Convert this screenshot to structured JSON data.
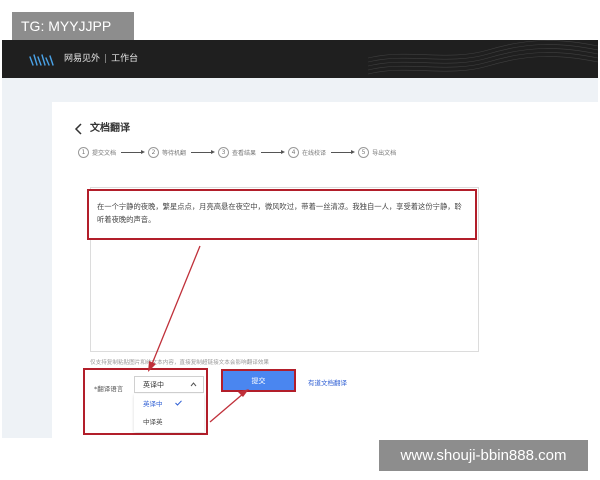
{
  "watermark": {
    "tg_text": "TG: MYYJJPP",
    "url_text": "www.shouji-bbin888.com"
  },
  "header": {
    "brand": "网易见外",
    "workspace": "工作台"
  },
  "page": {
    "title": "文档翻译"
  },
  "steps": [
    {
      "num": "1",
      "label": "提交文档"
    },
    {
      "num": "2",
      "label": "等待机翻"
    },
    {
      "num": "3",
      "label": "查看结果"
    },
    {
      "num": "4",
      "label": "在线校译"
    },
    {
      "num": "5",
      "label": "导出文档"
    }
  ],
  "editor": {
    "content": "在一个宁静的夜晚，繁星点点，月亮高悬在夜空中，微风吹过，带着一丝清凉。我独自一人，享受着这份宁静，聆听着夜晚的声音。",
    "hint": "仅支持复制粘贴图片和纯文本内容，直接复制超链接文本会影响翻译效果"
  },
  "language": {
    "label": "*翻译语言",
    "selected": "英译中",
    "options": [
      "英译中",
      "中译英"
    ]
  },
  "actions": {
    "submit_label": "提交",
    "link_label": "有道文档翻译"
  },
  "colors": {
    "highlight": "#b21e2a",
    "accent": "#4a86f0",
    "link": "#2f5fd4",
    "topbar": "#1f1f1f"
  }
}
